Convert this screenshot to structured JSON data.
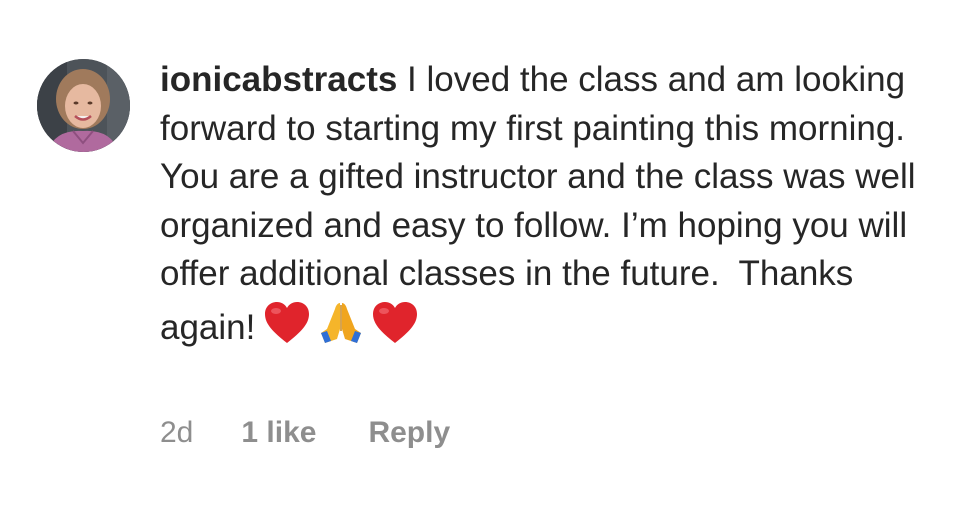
{
  "comment": {
    "avatar_icon": "profile-photo",
    "username": "ionicabstracts",
    "text": "I loved the class and am looking forward to starting my first painting this morning. You are a gifted instructor and the class was well organized and easy to follow. I’m hoping you will offer additional classes in the future.  Thanks again!",
    "emojis": [
      "red-heart-icon",
      "folded-hands-icon",
      "red-heart-icon"
    ],
    "timestamp": "2d",
    "likes_label": "1 like",
    "reply_label": "Reply"
  },
  "colors": {
    "text": "#262626",
    "secondary": "#8e8e8e",
    "heart": "#e0242c",
    "hands": "#f5b52a"
  }
}
